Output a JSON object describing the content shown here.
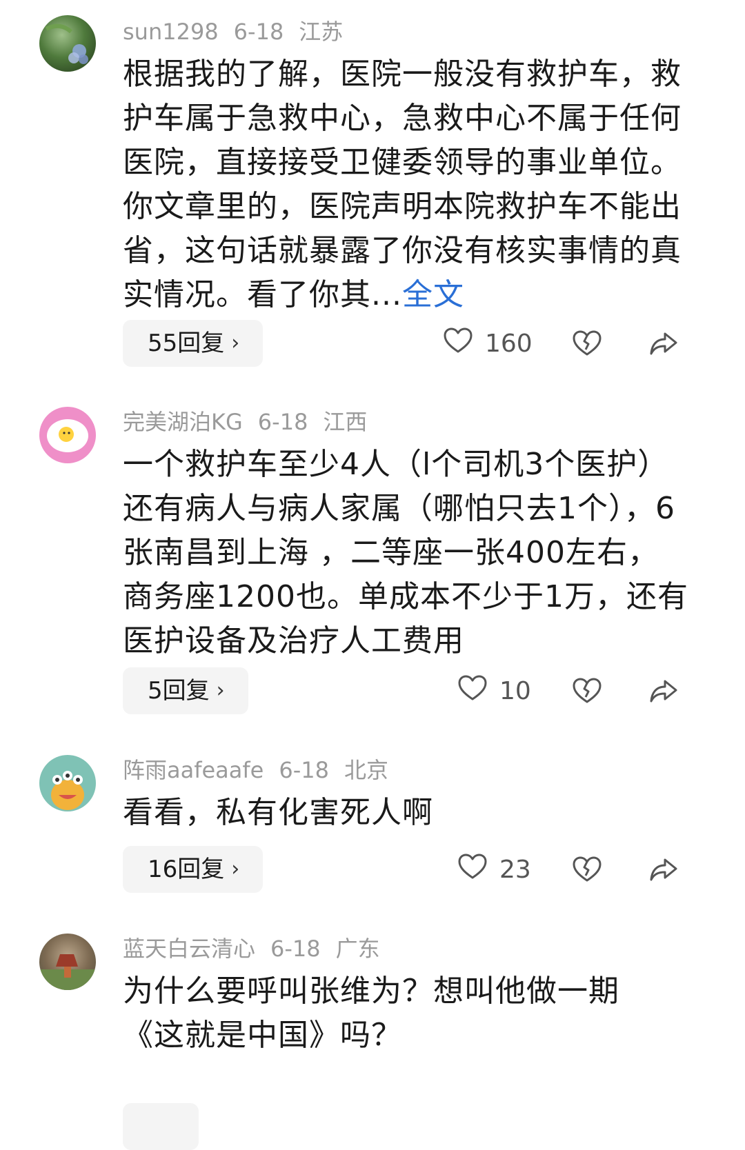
{
  "comments": [
    {
      "username": "sun1298",
      "date": "6-18",
      "location": "江苏",
      "text": "根据我的了解，医院一般没有救护车，救护车属于急救中心，急救中心不属于任何医院，直接接受卫健委领导的事业单位。你文章里的，医院声明本院救护车不能出省，这句话就暴露了你没有核实事情的真实情况。看了你其...",
      "more_label": "全文",
      "replies_label": "55回复",
      "likes": "160"
    },
    {
      "username": "完美湖泊KG",
      "date": "6-18",
      "location": "江西",
      "text": "一个救护车至少4人（l个司机3个医护）还有病人与病人家属（哪怕只去1个），6张南昌到上海 ，二等座一张400左右，商务座1200也。单成本不少于1万，还有医护设备及治疗人工费用",
      "replies_label": "5回复",
      "likes": "10"
    },
    {
      "username": "阵雨aafeaafe",
      "date": "6-18",
      "location": "北京",
      "text": "看看，私有化害死人啊",
      "replies_label": "16回复",
      "likes": "23"
    },
    {
      "username": "蓝天白云清心",
      "date": "6-18",
      "location": "广东",
      "text": "为什么要呼叫张维为？想叫他做一期《这就是中国》吗？"
    }
  ],
  "icons": {
    "chevron": "chevron-right-icon",
    "like": "heart-icon",
    "dislike": "broken-heart-icon",
    "share": "share-icon"
  },
  "colors": {
    "link": "#2a6fd6",
    "meta": "#9a9a9a",
    "pill_bg": "#f4f4f4"
  }
}
